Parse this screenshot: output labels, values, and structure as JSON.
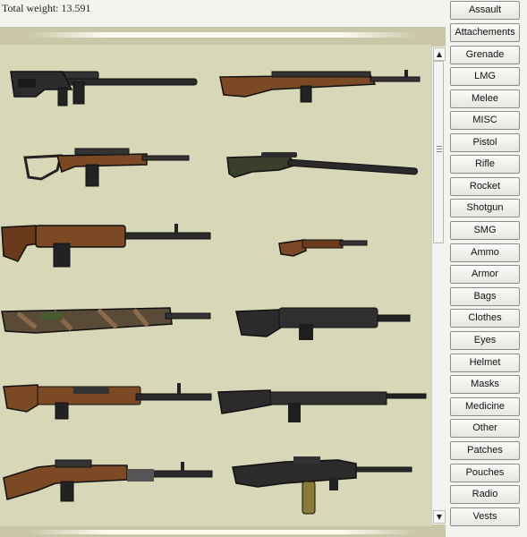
{
  "header": {
    "total_weight_label": "Total weight: 13.591"
  },
  "scrollbar": {
    "up_glyph": "▲",
    "down_glyph": "▼",
    "grip_glyph": "≡"
  },
  "colors": {
    "panel_bg": "#d8d7b7",
    "panel_band": "#c9c7a7",
    "wood": "#7a4a23",
    "metal": "#2b2b2b",
    "olive": "#3a3f2c"
  },
  "weapons": [
    {
      "icon": "sniper-rifle-black-icon"
    },
    {
      "icon": "wooden-battle-rifle-icon"
    },
    {
      "icon": "folding-stock-rifle-icon"
    },
    {
      "icon": "olive-sniper-rifle-icon"
    },
    {
      "icon": "wood-dmr-rifle-icon"
    },
    {
      "icon": "sawed-off-rifle-icon"
    },
    {
      "icon": "camo-wrapped-rifle-icon"
    },
    {
      "icon": "black-thumbhole-rifle-icon"
    },
    {
      "icon": "thumbhole-ak-icon"
    },
    {
      "icon": "black-battle-rifle-icon"
    },
    {
      "icon": "svd-sniper-rifle-icon"
    },
    {
      "icon": "bullpup-smg-icon"
    }
  ],
  "categories": [
    "Assault",
    "Attachements",
    "Grenade",
    "LMG",
    "Melee",
    "MISC",
    "Pistol",
    "Rifle",
    "Rocket",
    "Shotgun",
    "SMG",
    "Ammo",
    "Armor",
    "Bags",
    "Clothes",
    "Eyes",
    "Helmet",
    "Masks",
    "Medicine",
    "Other",
    "Patches",
    "Pouches",
    "Radio",
    "Vests"
  ]
}
